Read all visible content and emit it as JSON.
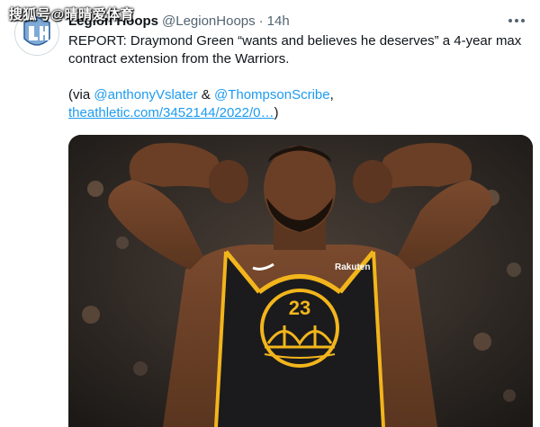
{
  "watermark": "搜狐号@晴晴爱体育",
  "tweet": {
    "author": {
      "display_name": "Legion Hoops",
      "handle": "@LegionHoops",
      "avatar_icon": "legion-hoops-logo-icon"
    },
    "separator": "·",
    "time": "14h",
    "text_line": "REPORT: Draymond Green “wants and believes he deserves” a 4-year max contract extension from the Warriors.",
    "via": {
      "open": "(via ",
      "mention1": "@anthonyVslater",
      "amp": " & ",
      "mention2": "@ThompsonScribe",
      "comma": ",",
      "link": "theathletic.com/3452144/2022/0…",
      "close": ")"
    },
    "more_icon": "more-dots-icon",
    "media": {
      "jersey_number": "23",
      "sponsor": "Rakuten",
      "colors": {
        "jersey": "#1b1b1d",
        "trim": "#f2b51c",
        "skin": "#6b4128",
        "link": "#1d9bf0"
      }
    }
  }
}
